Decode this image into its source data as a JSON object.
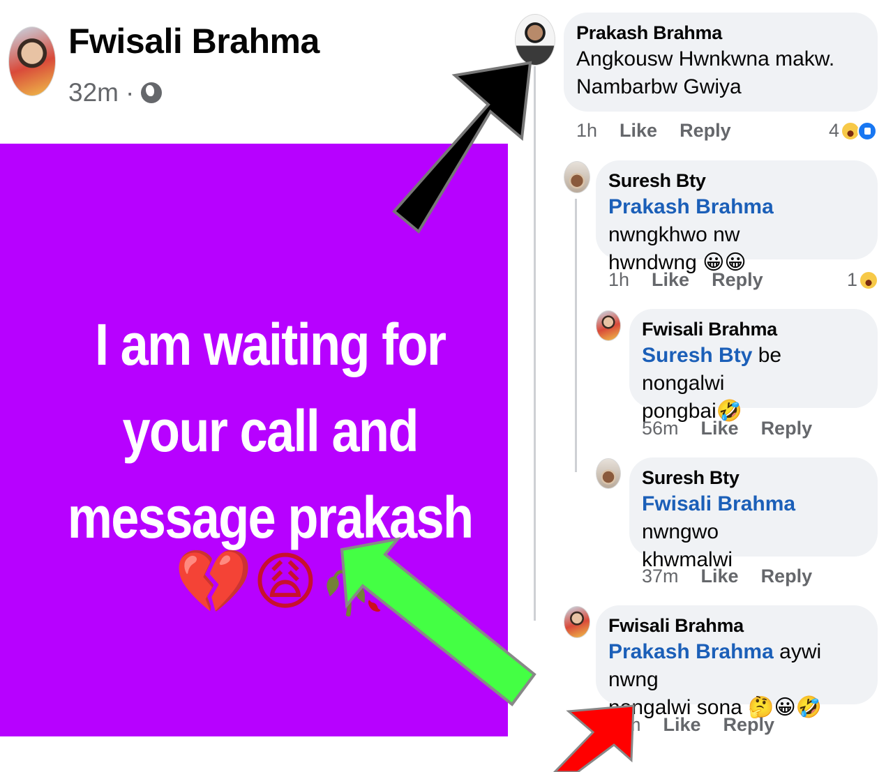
{
  "post": {
    "author": "Fwisali Brahma",
    "time": "32m",
    "separator": "·",
    "image_text": "I am waiting for your call and message prakash",
    "image_emoji": "💔😩🥀",
    "image_bg": "#b701ff"
  },
  "comments": [
    {
      "author": "Prakash Brahma",
      "text_line1": "Angkousw Hwnkwna makw.",
      "text_line2": "Nambarbw Gwiya",
      "time": "1h",
      "like": "Like",
      "reply": "Reply",
      "reaction_count": "4",
      "avatar_icon": "profile-photo-icon"
    },
    {
      "author": "Suresh Bty",
      "mention": "Prakash Brahma",
      "text_after": " nwngkhwo nw",
      "text_line2": "hwndwng 😀😀",
      "time": "1h",
      "like": "Like",
      "reply": "Reply",
      "reaction_count": "1"
    },
    {
      "author": "Fwisali Brahma",
      "mention": "Suresh Bty",
      "text_after": " be nongalwi",
      "text_line2": "pongbai🤣",
      "time": "56m",
      "like": "Like",
      "reply": "Reply"
    },
    {
      "author": "Suresh Bty",
      "mention": "Fwisali Brahma",
      "text_after": " nwngwo",
      "text_line2": "khwmalwi",
      "time": "37m",
      "like": "Like",
      "reply": "Reply"
    },
    {
      "author": "Fwisali Brahma",
      "mention": "Prakash Brahma",
      "text_after": " aywi nwng",
      "text_line2": "nongalwi sona 🤔😀🤣",
      "time": "m",
      "like": "Like",
      "reply": "Reply"
    }
  ],
  "annotations": {
    "arrow_colors": [
      "#000000",
      "#44ff44",
      "#ff0000"
    ]
  }
}
